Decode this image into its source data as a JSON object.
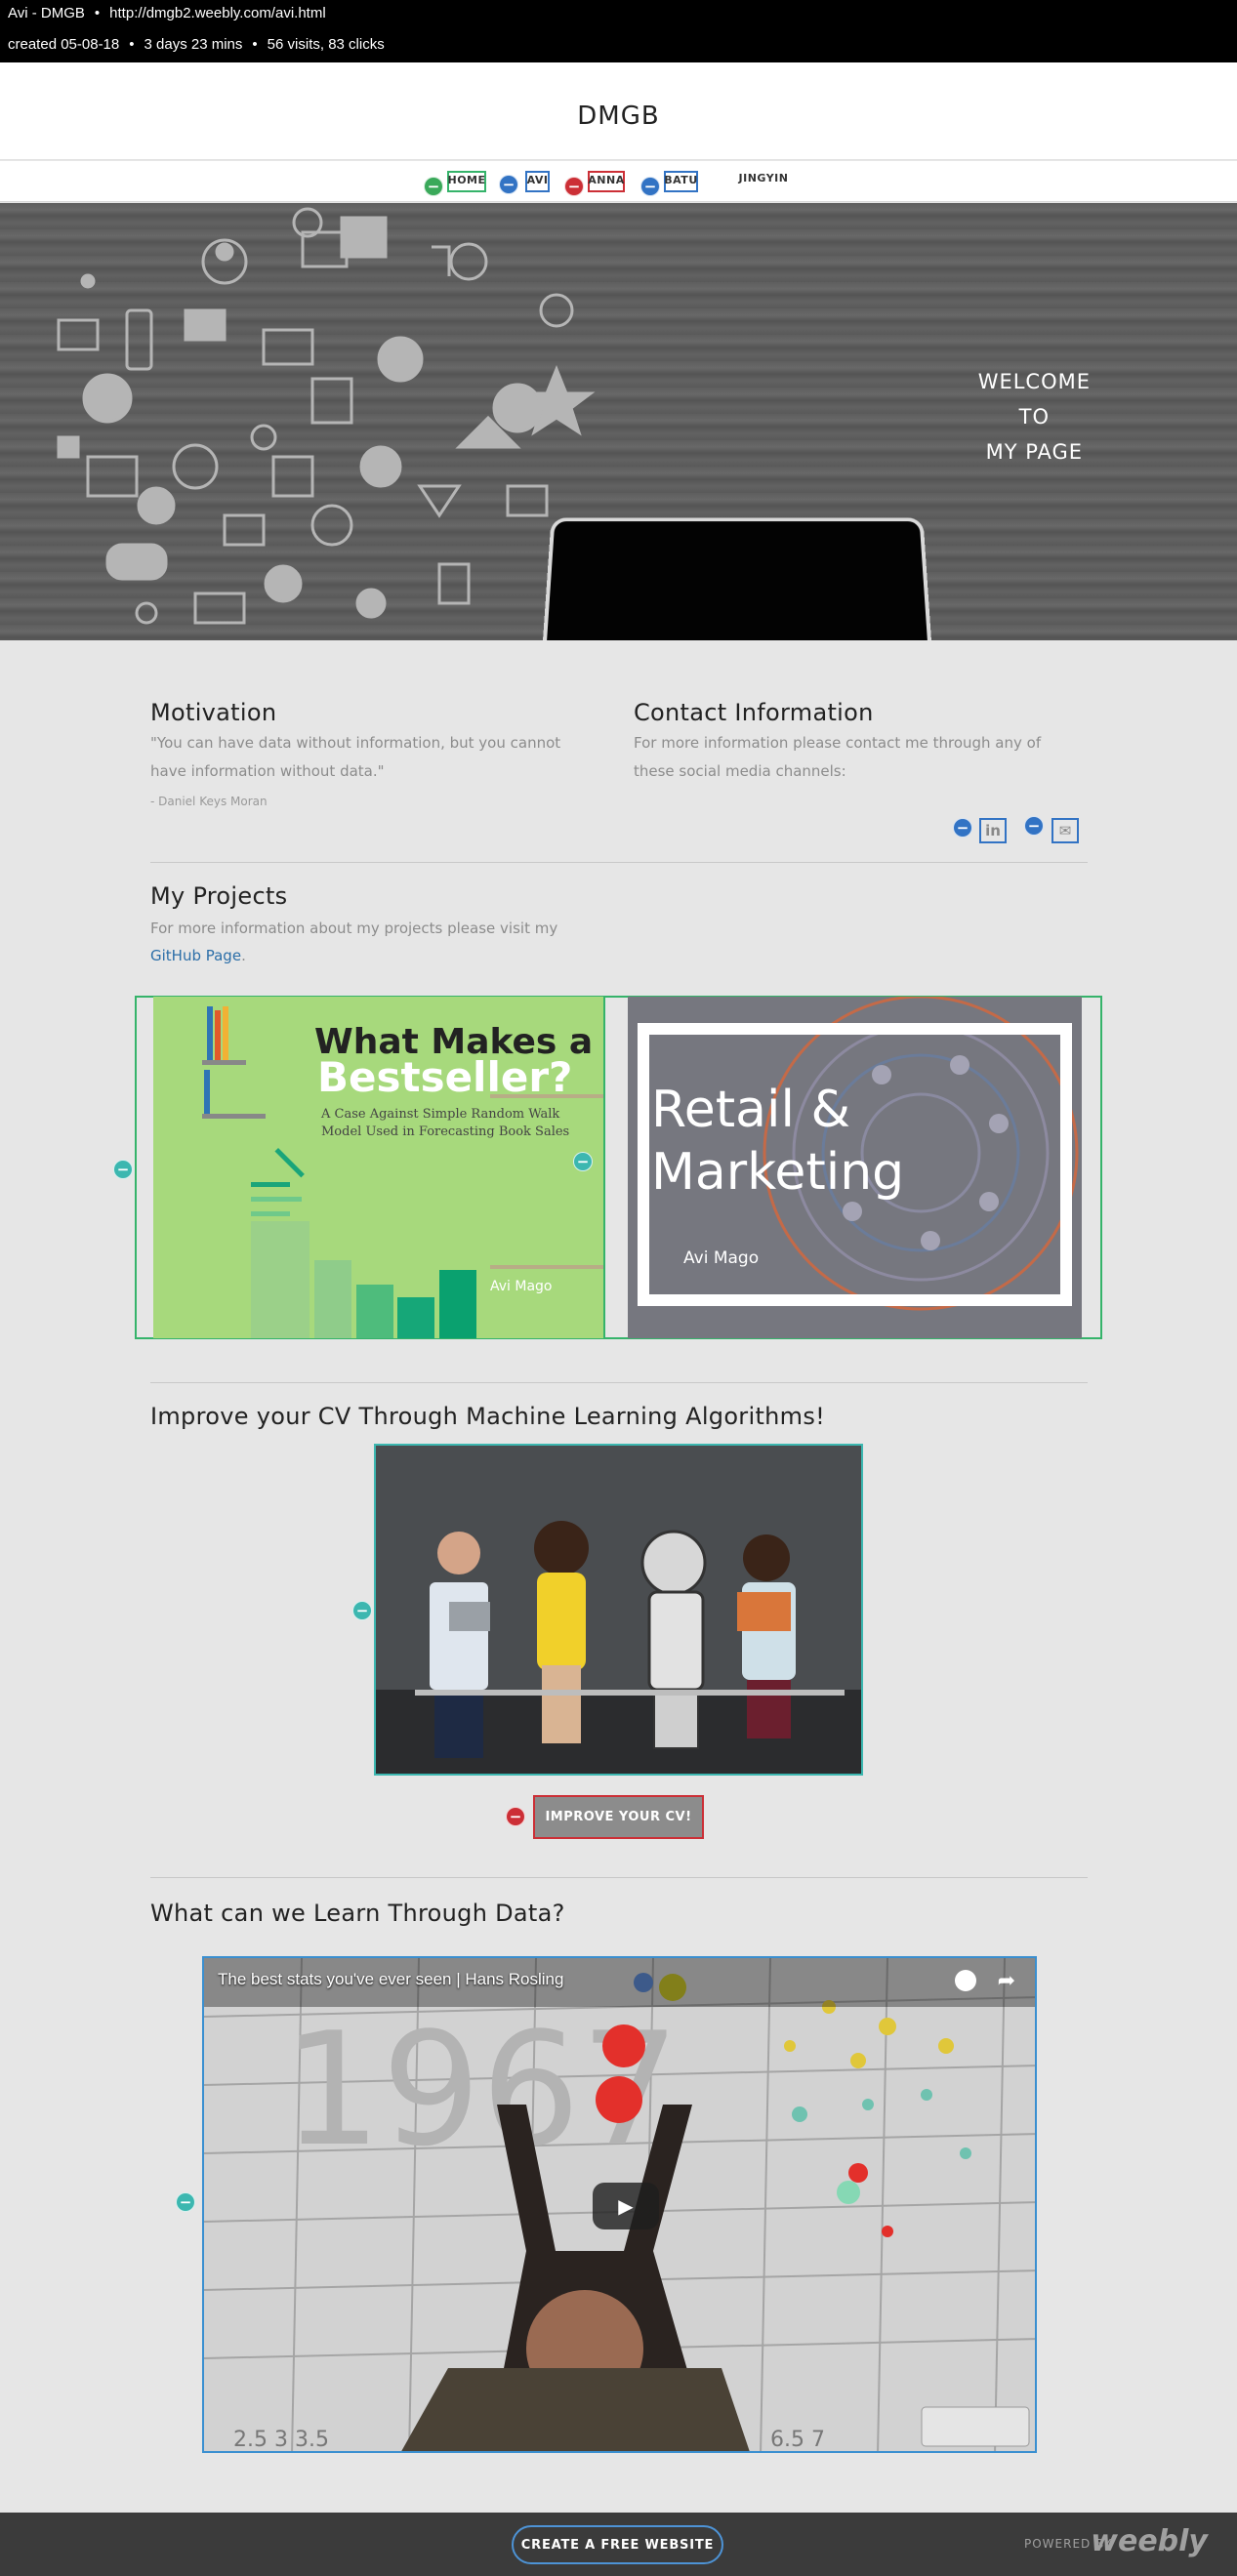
{
  "infobar": {
    "title": "Avi - DMGB",
    "url": "http://dmgb2.weebly.com/avi.html",
    "created": "created 05-08-18",
    "age": "3 days 23 mins",
    "visits": "56 visits, 83 clicks"
  },
  "site": {
    "title": "DMGB"
  },
  "nav": {
    "items": [
      "HOME",
      "AVI",
      "ANNA",
      "BATU",
      "JINGYIN"
    ]
  },
  "hero": {
    "line1": "WELCOME",
    "line2": "TO",
    "line3": "MY PAGE"
  },
  "motivation": {
    "heading": "Motivation",
    "quote_l1": "\"You can have data without information, but you cannot",
    "quote_l2": "have information without data.\"",
    "author": "- Daniel Keys Moran"
  },
  "contact": {
    "heading": "Contact Information",
    "text_l1": "For more information please contact me through any of",
    "text_l2": "these social media channels:",
    "linkedin": "in",
    "email": "✉"
  },
  "projects": {
    "heading": "My Projects",
    "text_l1": "For more information about my projects please visit my",
    "link": "GitHub Page",
    "after_link": ".",
    "card1": {
      "title1": "What Makes a",
      "title2": "Bestseller?",
      "sub": "A Case Against Simple Random Walk Model Used in Forecasting Book Sales",
      "author": "Avi Mago"
    },
    "card2": {
      "title1": "Retail &",
      "title2": "Marketing",
      "author": "Avi Mago"
    }
  },
  "cv": {
    "heading": "Improve your CV Through Machine Learning Algorithms!",
    "button": "IMPROVE YOUR CV!"
  },
  "learn": {
    "heading": "What can we Learn Through Data?",
    "video_title": "The best stats you've ever seen | Hans Rosling"
  },
  "footer": {
    "create": "CREATE A FREE WEBSITE",
    "powered": "POWERED BY",
    "brand": "weebly"
  }
}
